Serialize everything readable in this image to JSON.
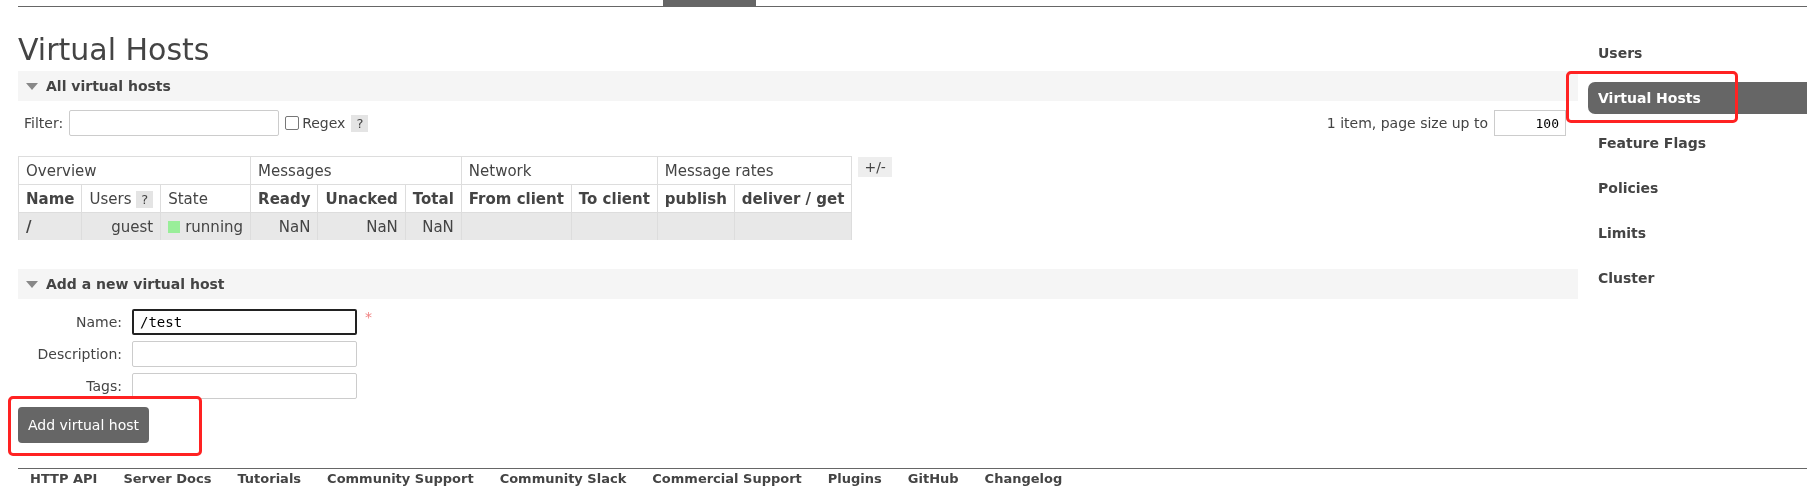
{
  "page_title": "Virtual Hosts",
  "sections": [
    {
      "title": "All virtual hosts",
      "expanded": true
    },
    {
      "title": "Add a new virtual host",
      "expanded": true
    }
  ],
  "filter": {
    "label": "Filter:",
    "regex": {
      "label": "Regex",
      "checked": false
    },
    "help": "?"
  },
  "paging": {
    "text": "1 item, page size up to",
    "page_size": "100"
  },
  "table": {
    "groups": [
      "Overview",
      "Messages",
      "Network",
      "Message rates"
    ],
    "toggle": "+/-",
    "columns": [
      {
        "label": "Name",
        "bold": true
      },
      {
        "label": "Users",
        "bold": false,
        "help": "?"
      },
      {
        "label": "State",
        "bold": false
      },
      {
        "label": "Ready",
        "bold": true
      },
      {
        "label": "Unacked",
        "bold": true
      },
      {
        "label": "Total",
        "bold": true
      },
      {
        "label": "From client",
        "bold": true
      },
      {
        "label": "To client",
        "bold": true
      },
      {
        "label": "publish",
        "bold": true
      },
      {
        "label": "deliver / get",
        "bold": true
      }
    ],
    "rows": [
      {
        "cells": [
          {
            "kind": "name",
            "text": "/"
          },
          {
            "kind": "right",
            "text": "guest"
          },
          {
            "kind": "state",
            "text": "running",
            "color": "#99ee99"
          },
          {
            "kind": "right",
            "text": "NaN"
          },
          {
            "kind": "right",
            "text": "NaN"
          },
          {
            "kind": "right",
            "text": "NaN"
          },
          {
            "kind": "empty"
          },
          {
            "kind": "empty"
          },
          {
            "kind": "empty"
          },
          {
            "kind": "empty"
          }
        ]
      }
    ]
  },
  "form": {
    "fields": [
      {
        "label": "Name:",
        "value": "/test",
        "required": true,
        "focused": true
      },
      {
        "label": "Description:",
        "required": false,
        "focused": false
      },
      {
        "label": "Tags:",
        "required": false,
        "focused": false
      }
    ],
    "required_mark": "*",
    "submit": "Add virtual host",
    "submit_highlighted": true
  },
  "sidebar": {
    "items": [
      {
        "label": "Users",
        "selected": false,
        "highlighted": false
      },
      {
        "label": "Virtual Hosts",
        "selected": true,
        "highlighted": true
      },
      {
        "label": "Feature Flags",
        "selected": false,
        "highlighted": false
      },
      {
        "label": "Policies",
        "selected": false,
        "highlighted": false
      },
      {
        "label": "Limits",
        "selected": false,
        "highlighted": false
      },
      {
        "label": "Cluster",
        "selected": false,
        "highlighted": false
      }
    ]
  },
  "footer": {
    "links": [
      "HTTP API",
      "Server Docs",
      "Tutorials",
      "Community Support",
      "Community Slack",
      "Commercial Support",
      "Plugins",
      "GitHub",
      "Changelog"
    ]
  }
}
